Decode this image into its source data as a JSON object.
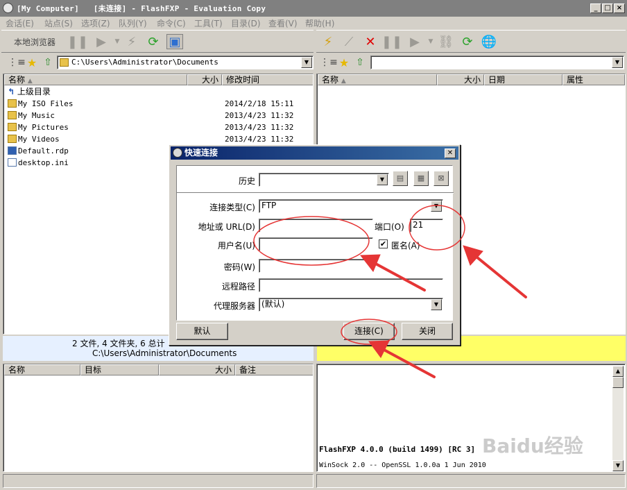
{
  "window": {
    "title": "[My Computer]   [未连接] - FlashFXP - Evaluation Copy",
    "controls": [
      "_",
      "□",
      "×"
    ]
  },
  "menu": [
    "会话(E)",
    "站点(S)",
    "选项(Z)",
    "队列(Y)",
    "命令(C)",
    "工具(T)",
    "目录(D)",
    "查看(V)",
    "帮助(H)"
  ],
  "left_toolbar": {
    "label": "本地浏览器"
  },
  "left_path": "C:\\Users\\Administrator\\Documents",
  "right_path": "",
  "left_columns": {
    "name": "名称",
    "size": "大小",
    "modified": "修改时间"
  },
  "right_columns": {
    "name": "名称",
    "size": "大小",
    "date": "日期",
    "attr": "属性"
  },
  "files": [
    {
      "name": "上级目录",
      "modified": "",
      "type": "up"
    },
    {
      "name": "My ISO Files",
      "modified": "2014/2/18 15:11",
      "type": "folder"
    },
    {
      "name": "My Music",
      "modified": "2013/4/23 11:32",
      "type": "folder"
    },
    {
      "name": "My Pictures",
      "modified": "2013/4/23 11:32",
      "type": "folder"
    },
    {
      "name": "My Videos",
      "modified": "2013/4/23 11:32",
      "type": "folder"
    },
    {
      "name": "Default.rdp",
      "modified": "",
      "type": "file"
    },
    {
      "name": "desktop.ini",
      "modified": "",
      "type": "file"
    }
  ],
  "left_status": {
    "line1": "2 文件, 4 文件夹, 6 总计",
    "line2": "C:\\Users\\Administrator\\Documents"
  },
  "queue_columns": {
    "name": "名称",
    "target": "目标",
    "size": "大小",
    "note": "备注"
  },
  "log": [
    "FlashFXP 4.0.0 (build 1499) [RC 3]",
    "WinSock 2.0 -- OpenSSL 1.0.0a 1 Jun 2010"
  ],
  "watermark": "Baidu经验",
  "dialog": {
    "title": "快速连接",
    "history_label": "历史",
    "history_value": "",
    "conn_type_label": "连接类型(C)",
    "conn_type_value": "FTP",
    "address_label": "地址或 URL(D)",
    "address_value": "",
    "port_label": "端口(O)",
    "port_value": "21",
    "user_label": "用户名(U)",
    "user_value": "",
    "anon_label": "匿名(A)",
    "anon_checked": true,
    "password_label": "密码(W)",
    "remote_path_label": "远程路径",
    "proxy_label": "代理服务器",
    "proxy_value": "(默认)",
    "default_button": "默认",
    "connect_button": "连接(C)",
    "close_button": "关闭"
  },
  "colors": {
    "titlebar": "#808080",
    "dialog_title_start": "#0a246a",
    "annotation": "#e53535",
    "right_status": "#ffff66",
    "left_status": "#e6f0ff"
  }
}
